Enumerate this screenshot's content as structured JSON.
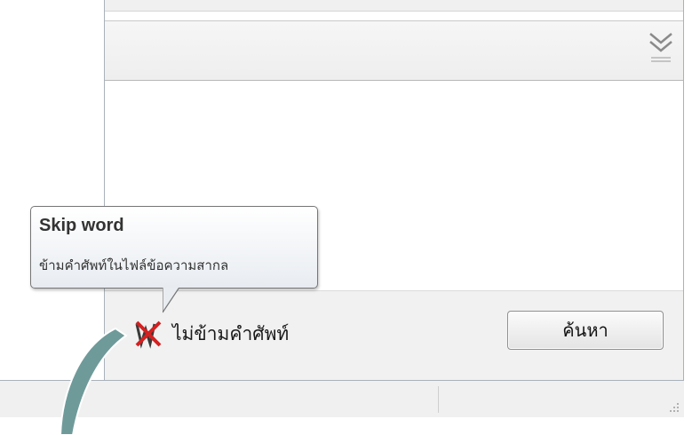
{
  "tooltip": {
    "title": "Skip word",
    "description": "ข้ามคำศัพท์ในไฟล์ข้อความสากล"
  },
  "footer": {
    "skip_toggle_label": "ไม่ข้ามคำศัพท์",
    "search_button_label": "ค้นหา"
  },
  "icons": {
    "expand": "chevron-double-down-icon",
    "skip_toggle": "crossed-out-word-icon",
    "resize_grip": "resize-grip-icon"
  },
  "colors": {
    "callout_arrow": "#6f9a9a",
    "skip_icon_red": "#d42020"
  }
}
